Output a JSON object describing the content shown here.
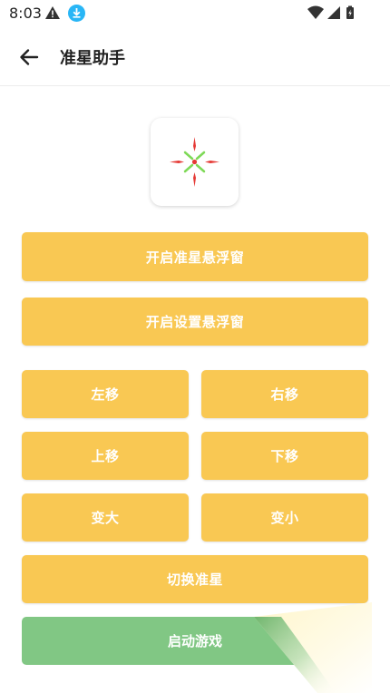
{
  "status_bar": {
    "time": "8:03",
    "icons": [
      "warning-icon",
      "download-icon",
      "wifi-icon",
      "signal-icon",
      "battery-icon"
    ]
  },
  "appbar": {
    "title": "准星助手",
    "back_icon": "arrow-left-icon"
  },
  "crosshair": {
    "icon": "crosshair-icon",
    "colors": {
      "outer": "#e53935",
      "inner": "#7ed957"
    }
  },
  "buttons": {
    "open_crosshair_overlay": "开启准星悬浮窗",
    "open_settings_overlay": "开启设置悬浮窗",
    "move_left": "左移",
    "move_right": "右移",
    "move_up": "上移",
    "move_down": "下移",
    "enlarge": "变大",
    "shrink": "变小",
    "switch_crosshair": "切换准星",
    "start_game": "启动游戏"
  },
  "colors": {
    "button": "#f9c853",
    "start_button": "#81c784",
    "text_on_button": "#ffffff"
  }
}
